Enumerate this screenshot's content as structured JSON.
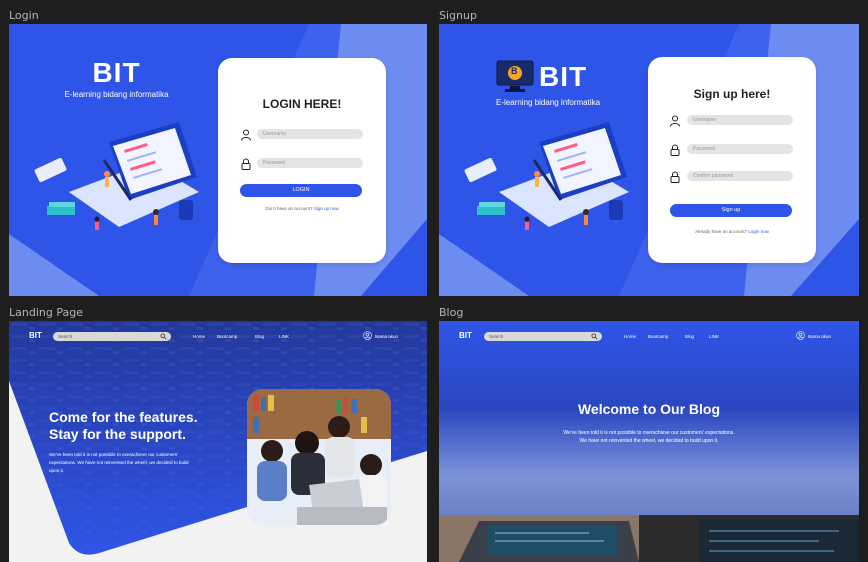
{
  "frames": {
    "login": "Login",
    "signup": "Signup",
    "landing": "Landing Page",
    "blog": "Blog"
  },
  "brand": {
    "name": "BIT",
    "tagline": "E-learning bidang informatika",
    "logo_letter": "B"
  },
  "login": {
    "title": "LOGIN HERE!",
    "username_placeholder": "Username",
    "password_placeholder": "Password",
    "button": "LOGIN",
    "footer_text": "Don't have an account?",
    "footer_link": "Sign up now"
  },
  "signup": {
    "title": "Sign up here!",
    "username_placeholder": "Username",
    "password_placeholder": "Password",
    "confirm_placeholder": "Confirm password",
    "button": "Sign up",
    "footer_text": "Already have an account?",
    "footer_link": "Login now"
  },
  "nav": {
    "logo": "BIT",
    "search_placeholder": "Search",
    "links": [
      "Home",
      "Bootcamp",
      "Blog",
      "LINK"
    ],
    "user": "Nama akun"
  },
  "landing": {
    "hero_title_line1": "Come for the features.",
    "hero_title_line2": "Stay for the support.",
    "hero_body_line1": "We've been told it is not possible to overachieve our customers'",
    "hero_body_line2": "expectations. We have not reinvented the wheel, we decided to build",
    "hero_body_line3": "upon it."
  },
  "blog": {
    "title": "Welcome to Our Blog",
    "body_line1": "We've been told it is not possible to overachieve our customers' expectations.",
    "body_line2": "We have not reinvented the wheel, we decided to build upon it."
  },
  "colors": {
    "primary": "#2f55e8",
    "canvas": "#1e1e1e",
    "light_blue": "#6d8cf2"
  },
  "icons": [
    "user-icon",
    "lock-icon",
    "search-icon",
    "account-icon",
    "monitor-logo-icon"
  ]
}
